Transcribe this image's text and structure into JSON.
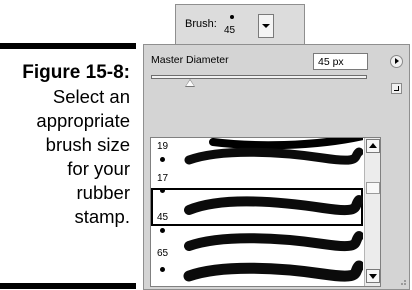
{
  "caption": {
    "figure": "Figure 15-8:",
    "lines": [
      "Select an",
      "appropriate",
      "brush size",
      "for your",
      "rubber",
      "stamp."
    ]
  },
  "options_bar": {
    "brush_label": "Brush:",
    "brush_size": "45"
  },
  "panel": {
    "master_diameter_label": "Master Diameter",
    "diameter_value": "45 px",
    "slider_level_percent": 18
  },
  "brush_list": {
    "visible_sizes": [
      "19",
      "17",
      "45",
      "65"
    ],
    "selected": "45"
  },
  "icons": {
    "flyout_menu": "right-triangle-icon",
    "save_preset": "save-preset-icon",
    "dropdown": "chevron-down-icon"
  }
}
